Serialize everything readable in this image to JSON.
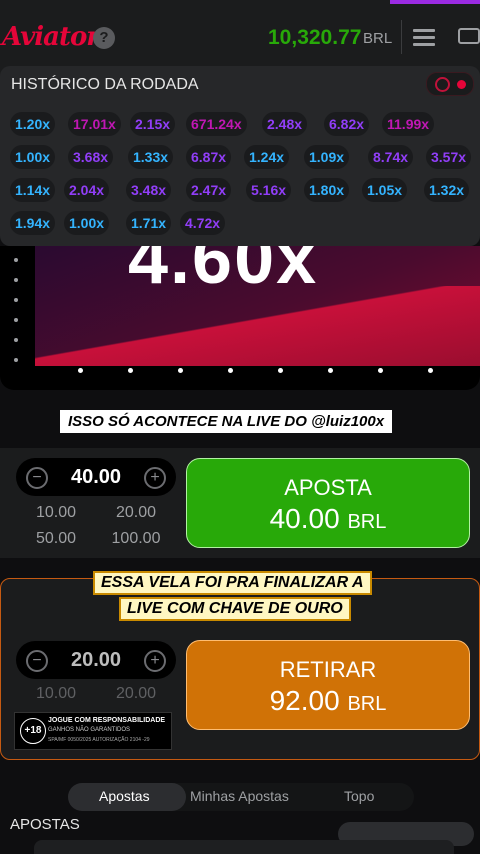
{
  "header": {
    "logo": "Aviator",
    "help": "?",
    "balance": "10,320.77",
    "currency": "BRL"
  },
  "history": {
    "title": "HISTÓRICO DA RODADA",
    "rows": [
      [
        {
          "v": "1.20x",
          "c": "#34b4ff"
        },
        {
          "v": "17.01x",
          "c": "#c017b4"
        },
        {
          "v": "2.15x",
          "c": "#913ef8"
        },
        {
          "v": "671.24x",
          "c": "#c017b4"
        },
        {
          "v": "2.48x",
          "c": "#913ef8"
        },
        {
          "v": "6.82x",
          "c": "#913ef8"
        },
        {
          "v": "11.99x",
          "c": "#c017b4"
        }
      ],
      [
        {
          "v": "1.00x",
          "c": "#34b4ff"
        },
        {
          "v": "3.68x",
          "c": "#913ef8"
        },
        {
          "v": "1.33x",
          "c": "#34b4ff"
        },
        {
          "v": "6.87x",
          "c": "#913ef8"
        },
        {
          "v": "1.24x",
          "c": "#34b4ff"
        },
        {
          "v": "1.09x",
          "c": "#34b4ff"
        },
        {
          "v": "8.74x",
          "c": "#913ef8"
        },
        {
          "v": "3.57x",
          "c": "#913ef8"
        }
      ],
      [
        {
          "v": "1.14x",
          "c": "#34b4ff"
        },
        {
          "v": "2.04x",
          "c": "#913ef8"
        },
        {
          "v": "3.48x",
          "c": "#913ef8"
        },
        {
          "v": "2.47x",
          "c": "#913ef8"
        },
        {
          "v": "5.16x",
          "c": "#913ef8"
        },
        {
          "v": "1.80x",
          "c": "#34b4ff"
        },
        {
          "v": "1.05x",
          "c": "#34b4ff"
        },
        {
          "v": "1.32x",
          "c": "#34b4ff"
        }
      ],
      [
        {
          "v": "1.94x",
          "c": "#34b4ff"
        },
        {
          "v": "1.00x",
          "c": "#34b4ff"
        },
        {
          "v": "1.71x",
          "c": "#34b4ff"
        },
        {
          "v": "4.72x",
          "c": "#913ef8"
        }
      ]
    ]
  },
  "game": {
    "multiplier": "4.60x"
  },
  "overlay": {
    "banner": "ISSO SÓ ACONTECE NA LIVE DO @luiz100x",
    "caption_line1": "ESSA VELA FOI PRA FINALIZAR A",
    "caption_line2": "LIVE COM CHAVE DE OURO"
  },
  "bet1": {
    "amount": "40.00",
    "quick": [
      "10.00",
      "20.00",
      "50.00",
      "100.00"
    ],
    "button_label": "APOSTA",
    "button_value": "40.00",
    "button_currency": "BRL"
  },
  "bet2": {
    "amount": "20.00",
    "quick": [
      "10.00",
      "20.00"
    ],
    "button_label": "RETIRAR",
    "button_value": "92.00",
    "button_currency": "BRL"
  },
  "responsible": {
    "age": "+18",
    "line1": "JOGUE COM RESPONSABILIDADE",
    "line2": "GANHOS NÃO GARANTIDOS",
    "line3": "SPA/MF 0050/2025 AUTORIZAÇÃO 2104 -29"
  },
  "tabs": [
    "Apostas",
    "Minhas Apostas",
    "Topo"
  ],
  "section_title": "APOSTAS",
  "colors": {
    "brand_red": "#e50539",
    "balance_green": "#28a909",
    "bet_green": "#28a909",
    "cashout_orange": "#d07206"
  }
}
